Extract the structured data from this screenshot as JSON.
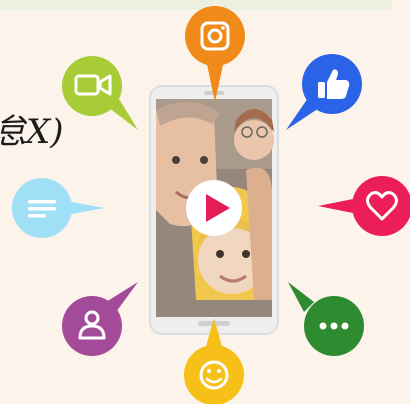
{
  "partial_text": "怠X)",
  "colors": {
    "background": "#fcf3ea",
    "instagram": "#f08a18",
    "like": "#2b63e8",
    "video": "#a7cc35",
    "heart": "#ec1e58",
    "message": "#9fe0f6",
    "more": "#2f8b2f",
    "profile": "#a34a98",
    "smile": "#f7c018",
    "play": "#e61e57"
  },
  "icons": [
    "instagram-icon",
    "like-icon",
    "video-camera-icon",
    "heart-icon",
    "message-icon",
    "more-icon",
    "profile-icon",
    "smile-icon",
    "play-icon"
  ]
}
